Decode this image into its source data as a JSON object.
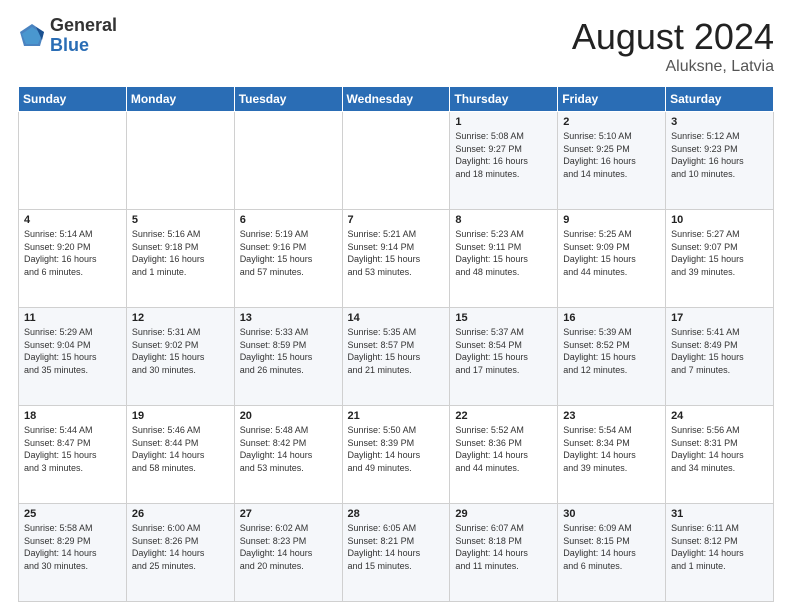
{
  "logo": {
    "general": "General",
    "blue": "Blue"
  },
  "title": {
    "month_year": "August 2024",
    "location": "Aluksne, Latvia"
  },
  "days_of_week": [
    "Sunday",
    "Monday",
    "Tuesday",
    "Wednesday",
    "Thursday",
    "Friday",
    "Saturday"
  ],
  "weeks": [
    [
      {
        "day": "",
        "info": ""
      },
      {
        "day": "",
        "info": ""
      },
      {
        "day": "",
        "info": ""
      },
      {
        "day": "",
        "info": ""
      },
      {
        "day": "1",
        "info": "Sunrise: 5:08 AM\nSunset: 9:27 PM\nDaylight: 16 hours\nand 18 minutes."
      },
      {
        "day": "2",
        "info": "Sunrise: 5:10 AM\nSunset: 9:25 PM\nDaylight: 16 hours\nand 14 minutes."
      },
      {
        "day": "3",
        "info": "Sunrise: 5:12 AM\nSunset: 9:23 PM\nDaylight: 16 hours\nand 10 minutes."
      }
    ],
    [
      {
        "day": "4",
        "info": "Sunrise: 5:14 AM\nSunset: 9:20 PM\nDaylight: 16 hours\nand 6 minutes."
      },
      {
        "day": "5",
        "info": "Sunrise: 5:16 AM\nSunset: 9:18 PM\nDaylight: 16 hours\nand 1 minute."
      },
      {
        "day": "6",
        "info": "Sunrise: 5:19 AM\nSunset: 9:16 PM\nDaylight: 15 hours\nand 57 minutes."
      },
      {
        "day": "7",
        "info": "Sunrise: 5:21 AM\nSunset: 9:14 PM\nDaylight: 15 hours\nand 53 minutes."
      },
      {
        "day": "8",
        "info": "Sunrise: 5:23 AM\nSunset: 9:11 PM\nDaylight: 15 hours\nand 48 minutes."
      },
      {
        "day": "9",
        "info": "Sunrise: 5:25 AM\nSunset: 9:09 PM\nDaylight: 15 hours\nand 44 minutes."
      },
      {
        "day": "10",
        "info": "Sunrise: 5:27 AM\nSunset: 9:07 PM\nDaylight: 15 hours\nand 39 minutes."
      }
    ],
    [
      {
        "day": "11",
        "info": "Sunrise: 5:29 AM\nSunset: 9:04 PM\nDaylight: 15 hours\nand 35 minutes."
      },
      {
        "day": "12",
        "info": "Sunrise: 5:31 AM\nSunset: 9:02 PM\nDaylight: 15 hours\nand 30 minutes."
      },
      {
        "day": "13",
        "info": "Sunrise: 5:33 AM\nSunset: 8:59 PM\nDaylight: 15 hours\nand 26 minutes."
      },
      {
        "day": "14",
        "info": "Sunrise: 5:35 AM\nSunset: 8:57 PM\nDaylight: 15 hours\nand 21 minutes."
      },
      {
        "day": "15",
        "info": "Sunrise: 5:37 AM\nSunset: 8:54 PM\nDaylight: 15 hours\nand 17 minutes."
      },
      {
        "day": "16",
        "info": "Sunrise: 5:39 AM\nSunset: 8:52 PM\nDaylight: 15 hours\nand 12 minutes."
      },
      {
        "day": "17",
        "info": "Sunrise: 5:41 AM\nSunset: 8:49 PM\nDaylight: 15 hours\nand 7 minutes."
      }
    ],
    [
      {
        "day": "18",
        "info": "Sunrise: 5:44 AM\nSunset: 8:47 PM\nDaylight: 15 hours\nand 3 minutes."
      },
      {
        "day": "19",
        "info": "Sunrise: 5:46 AM\nSunset: 8:44 PM\nDaylight: 14 hours\nand 58 minutes."
      },
      {
        "day": "20",
        "info": "Sunrise: 5:48 AM\nSunset: 8:42 PM\nDaylight: 14 hours\nand 53 minutes."
      },
      {
        "day": "21",
        "info": "Sunrise: 5:50 AM\nSunset: 8:39 PM\nDaylight: 14 hours\nand 49 minutes."
      },
      {
        "day": "22",
        "info": "Sunrise: 5:52 AM\nSunset: 8:36 PM\nDaylight: 14 hours\nand 44 minutes."
      },
      {
        "day": "23",
        "info": "Sunrise: 5:54 AM\nSunset: 8:34 PM\nDaylight: 14 hours\nand 39 minutes."
      },
      {
        "day": "24",
        "info": "Sunrise: 5:56 AM\nSunset: 8:31 PM\nDaylight: 14 hours\nand 34 minutes."
      }
    ],
    [
      {
        "day": "25",
        "info": "Sunrise: 5:58 AM\nSunset: 8:29 PM\nDaylight: 14 hours\nand 30 minutes."
      },
      {
        "day": "26",
        "info": "Sunrise: 6:00 AM\nSunset: 8:26 PM\nDaylight: 14 hours\nand 25 minutes."
      },
      {
        "day": "27",
        "info": "Sunrise: 6:02 AM\nSunset: 8:23 PM\nDaylight: 14 hours\nand 20 minutes."
      },
      {
        "day": "28",
        "info": "Sunrise: 6:05 AM\nSunset: 8:21 PM\nDaylight: 14 hours\nand 15 minutes."
      },
      {
        "day": "29",
        "info": "Sunrise: 6:07 AM\nSunset: 8:18 PM\nDaylight: 14 hours\nand 11 minutes."
      },
      {
        "day": "30",
        "info": "Sunrise: 6:09 AM\nSunset: 8:15 PM\nDaylight: 14 hours\nand 6 minutes."
      },
      {
        "day": "31",
        "info": "Sunrise: 6:11 AM\nSunset: 8:12 PM\nDaylight: 14 hours\nand 1 minute."
      }
    ]
  ]
}
